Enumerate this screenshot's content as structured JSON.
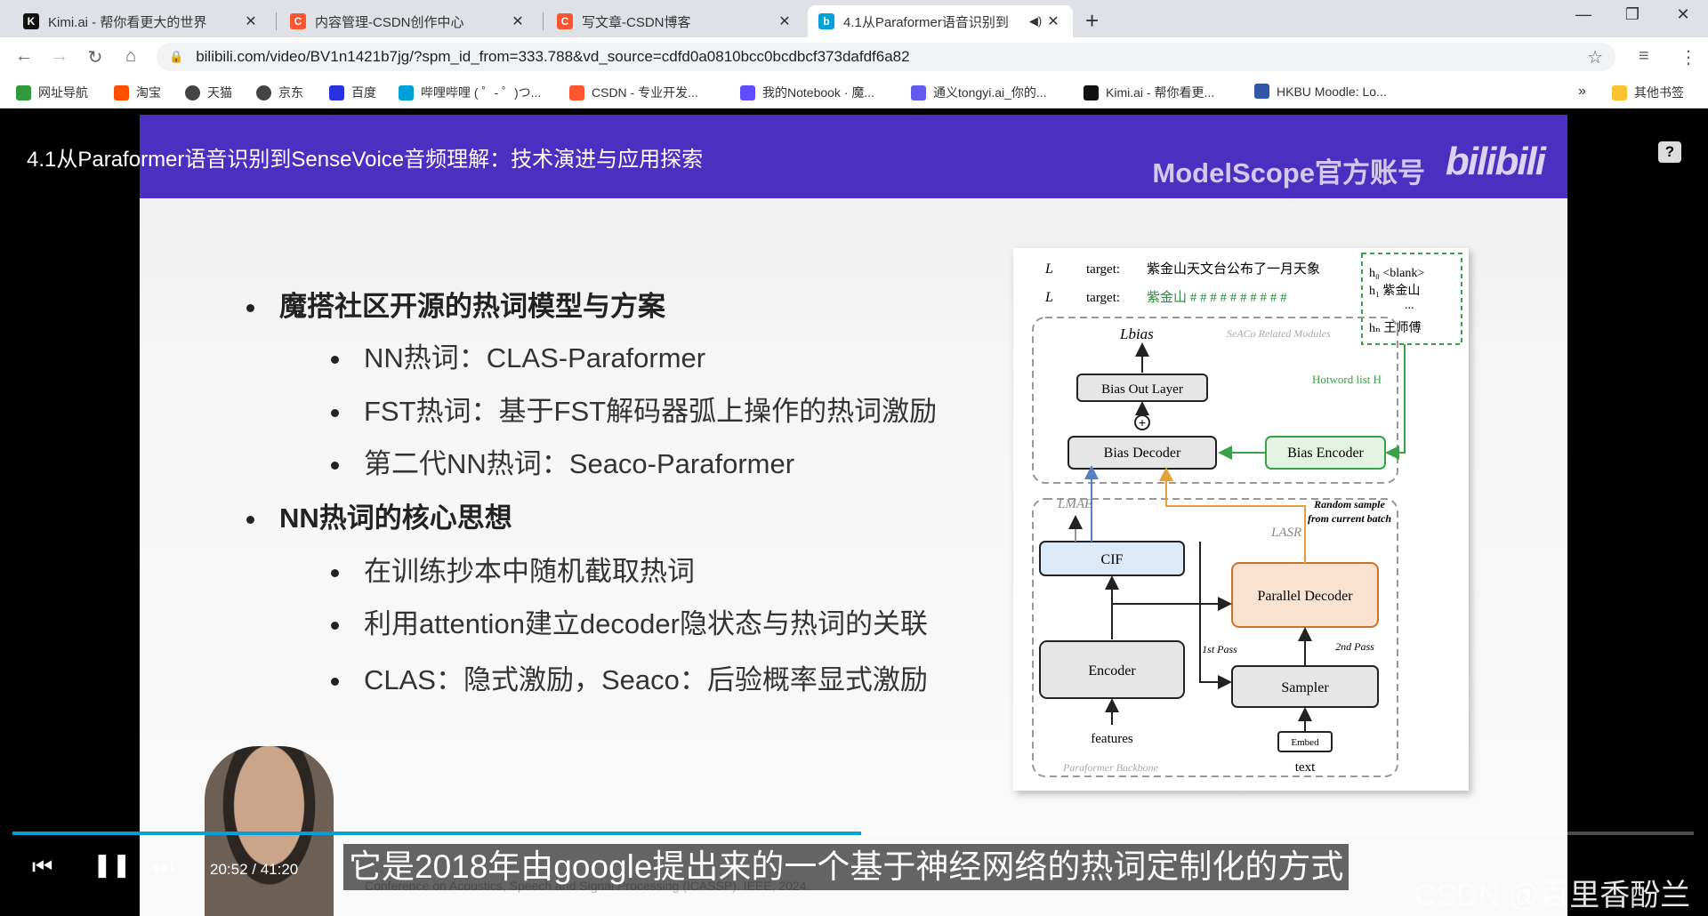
{
  "browser": {
    "tabs": [
      {
        "title": "Kimi.ai - 帮你看更大的世界",
        "icon": "kimi-icon",
        "color": "#111111",
        "glyph": "K"
      },
      {
        "title": "内容管理-CSDN创作中心",
        "icon": "csdn-icon",
        "color": "#fc5531",
        "glyph": "C"
      },
      {
        "title": "写文章-CSDN博客",
        "icon": "csdn-icon",
        "color": "#fc5531",
        "glyph": "C"
      },
      {
        "title": "4.1从Paraformer语音识别到",
        "icon": "bilibili-icon",
        "color": "#00a1d6",
        "glyph": "b"
      }
    ],
    "new_tab": "+",
    "address": "bilibili.com/video/BV1n1421b7jg/?spm_id_from=333.788&vd_source=cdfd0a0810bcc0bcdbcf373dafdf6a82",
    "bookmarks": [
      {
        "label": "网址导航",
        "color": "#2e9a3a"
      },
      {
        "label": "淘宝",
        "color": "#ff5000"
      },
      {
        "label": "天猫",
        "color": "#444444"
      },
      {
        "label": "京东",
        "color": "#444444"
      },
      {
        "label": "百度",
        "color": "#2932e1"
      },
      {
        "label": "哔哩哔哩 ( ゜- ゜)つ...",
        "color": "#00a1d6"
      },
      {
        "label": "CSDN - 专业开发...",
        "color": "#fc5531"
      },
      {
        "label": "我的Notebook · 魔...",
        "color": "#624aff"
      },
      {
        "label": "通义tongyi.ai_你的...",
        "color": "#615ced"
      },
      {
        "label": "Kimi.ai - 帮你看更...",
        "color": "#111111"
      },
      {
        "label": "HKBU Moodle: Lo...",
        "color": "#3355aa"
      }
    ],
    "more": "»",
    "other_bookmarks": "其他书签"
  },
  "video": {
    "title": "4.1从Paraformer语音识别到SenseVoice音频理解：技术演进与应用探索",
    "brand": "ModelScope官方账号",
    "bili_logo": "bilibili",
    "help": "?",
    "time": "20:52 / 41:20",
    "progress": 0.505,
    "subtitle": "它是2018年由google提出来的一个基于神经网络的热词定制化的方式",
    "watermark": "CSDN @百里香酚兰",
    "citation": "Conference on Acoustics, Speech and Signal Processing (ICASSP). IEEE, 2024."
  },
  "slide": {
    "sections": [
      {
        "heading": "魔搭社区开源的热词模型与方案",
        "items": [
          "NN热词：CLAS-Paraformer",
          "FST热词：基于FST解码器弧上操作的热词激励",
          "第二代NN热词：Seaco-Paraformer"
        ]
      },
      {
        "heading": "NN热词的核心思想",
        "items": [
          "在训练抄本中随机截取热词",
          "利用attention建立decoder隐状态与热词的关联",
          "CLAS：隐式激励，Seaco：后验概率显式激励"
        ]
      }
    ]
  },
  "diagram": {
    "lasr_label": "target:",
    "lasr_target": "紫金山天文台公布了一月天象",
    "lbias_label": "target:",
    "lbias_target": "紫金山 # # # # # # # # # #",
    "hotwords": [
      "h₀ <blank>",
      "h₁ 紫金山",
      "...",
      "hₙ 王师傅"
    ],
    "seaco_label": "SeACo Related Modules",
    "hotword_list": "Hotword list H",
    "lbias": "Lbias",
    "bias_out": "Bias Out Layer",
    "bias_decoder": "Bias Decoder",
    "bias_encoder": "Bias Encoder",
    "random_sample": "Random sample from current batch",
    "lmae": "LMAE",
    "lasr": "LASR",
    "cif": "CIF",
    "parallel_decoder": "Parallel Decoder",
    "encoder": "Encoder",
    "sampler": "Sampler",
    "first_pass": "1st Pass",
    "second_pass": "2nd Pass",
    "features": "features",
    "embed": "Embed",
    "text": "text",
    "backbone": "Paraformer Backbone"
  }
}
